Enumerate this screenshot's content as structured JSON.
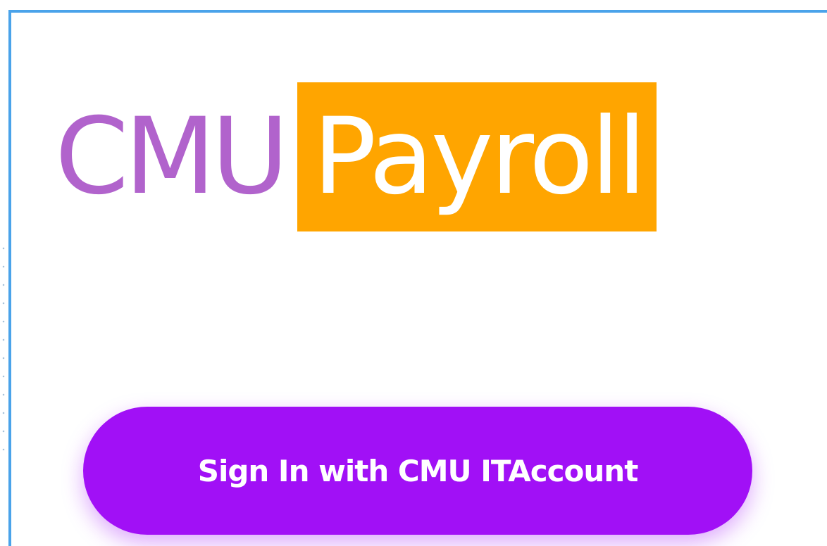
{
  "logo": {
    "part1": "CMU",
    "part2": "Payroll",
    "colors": {
      "cmu_text": "#b163cc",
      "payroll_bg": "#ffa500",
      "payroll_text": "#ffffff"
    }
  },
  "signin": {
    "label": "Sign In with CMU ITAccount",
    "color": "#a110f6"
  },
  "theme": {
    "border_color": "#4aa3ea",
    "background": "#ffffff"
  }
}
